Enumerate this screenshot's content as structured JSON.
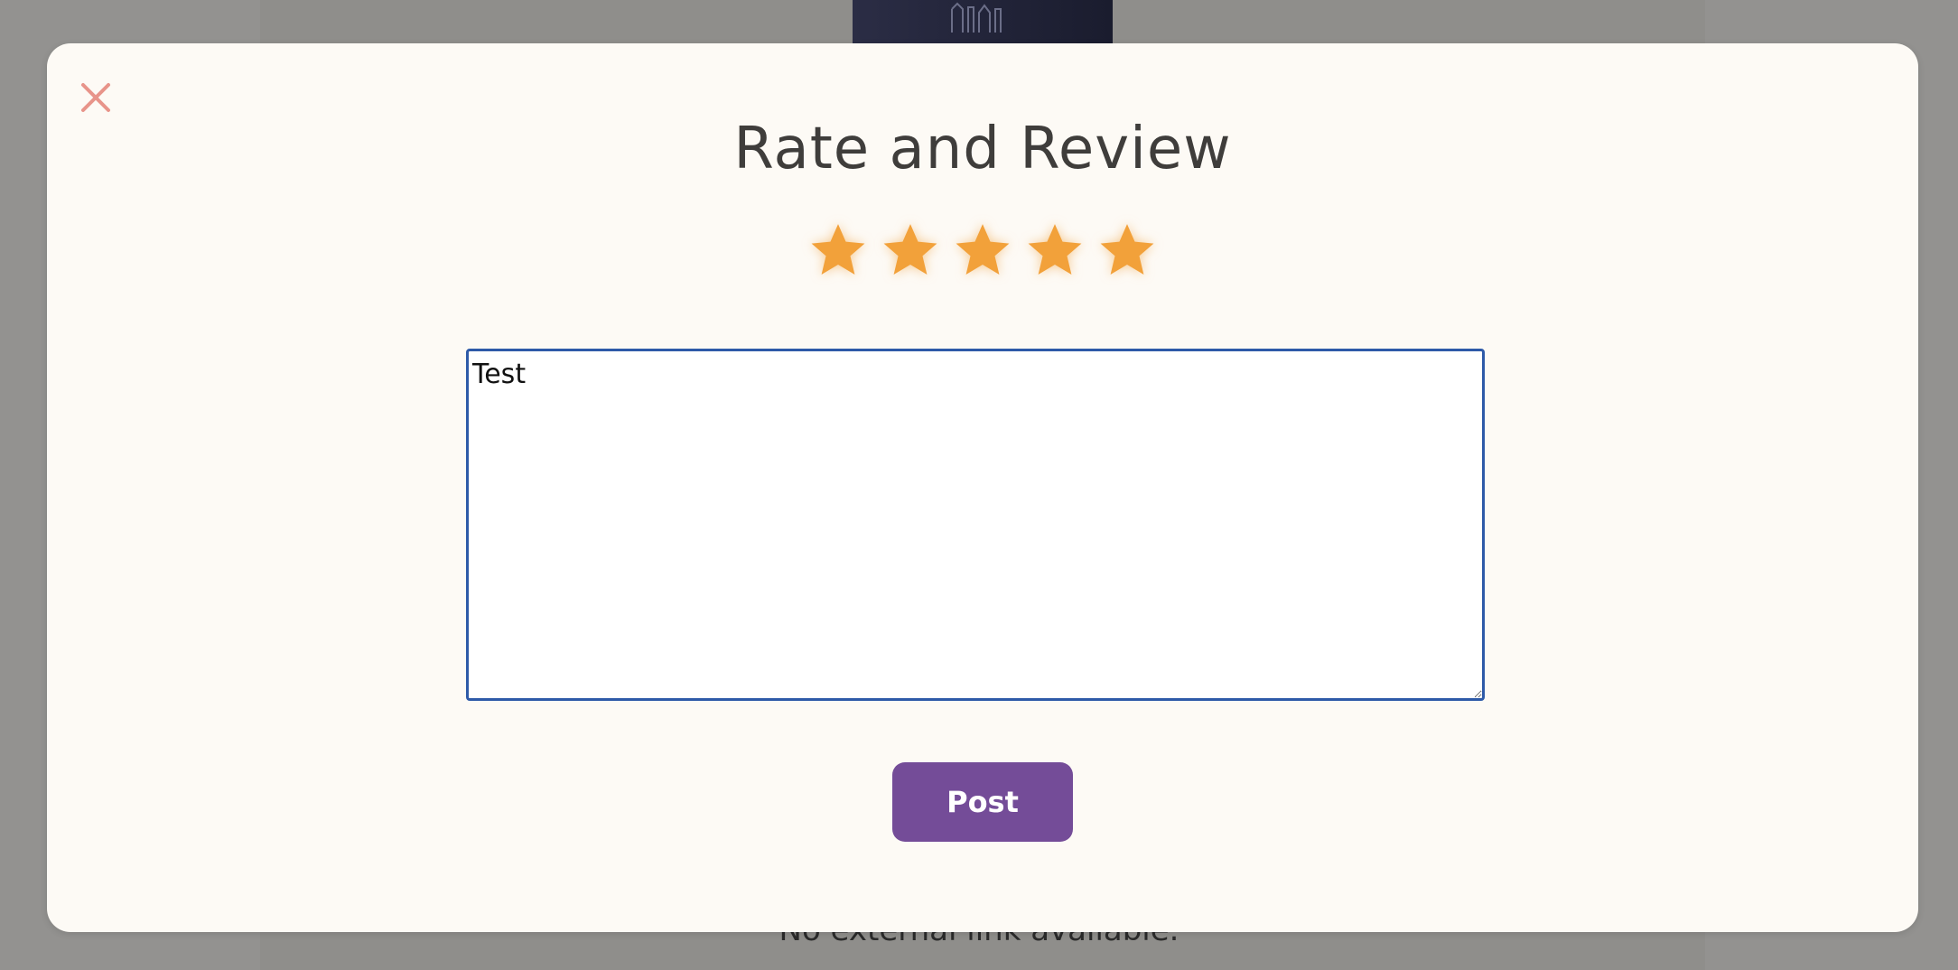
{
  "background": {
    "footer_text": "No external link available."
  },
  "modal": {
    "title": "Rate and Review",
    "close_icon": "close-icon",
    "rating": {
      "value": 5,
      "max": 5,
      "icon": "star-icon",
      "color": "#f2a13a"
    },
    "review": {
      "value": "Test",
      "placeholder": ""
    },
    "post_label": "Post"
  },
  "colors": {
    "overlay": "#939290",
    "modal_bg": "#fdfaf5",
    "close": "#e8948a",
    "button": "#744c98",
    "focus_border": "#2e5aa8"
  }
}
